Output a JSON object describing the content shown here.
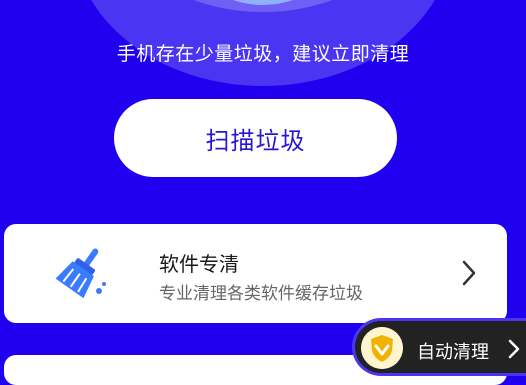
{
  "header": {
    "status_text": "手机存在少量垃圾，建议立即清理"
  },
  "scan_button": {
    "label": "扫描垃圾"
  },
  "software_card": {
    "title": "软件专清",
    "subtitle": "专业清理各类软件缓存垃圾",
    "icon": "broom-icon"
  },
  "auto_clean": {
    "label": "自动清理",
    "icon": "shield-heart-icon"
  },
  "colors": {
    "background": "#2100f0",
    "accent_text": "#2a14d8",
    "icon_blue": "#3a7bff"
  }
}
